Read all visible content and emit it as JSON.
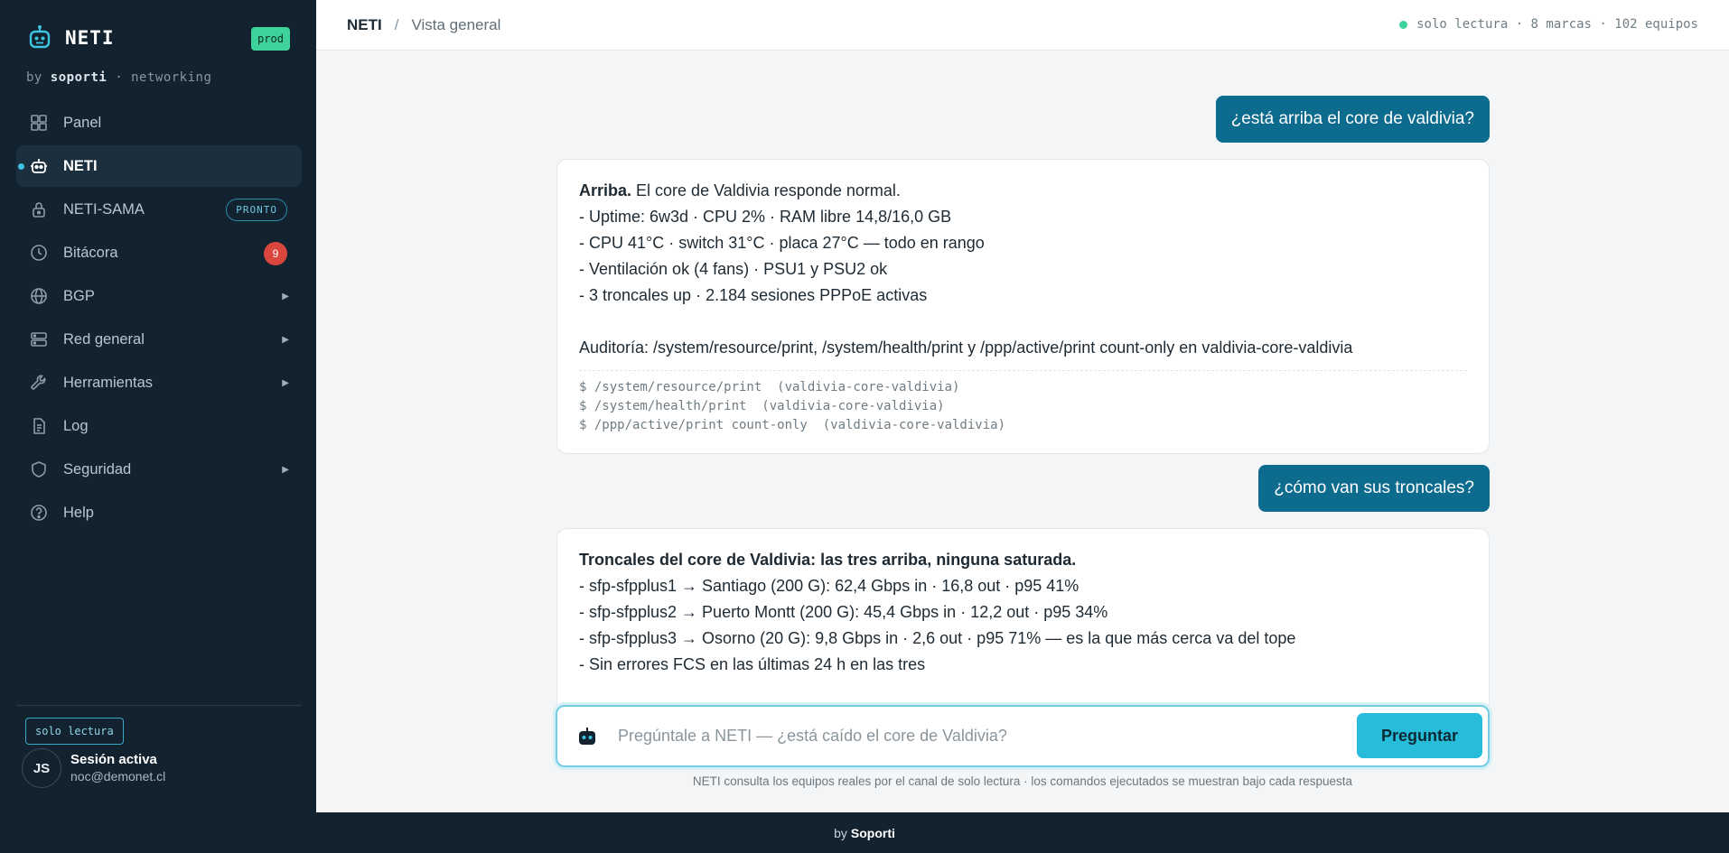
{
  "sidebar": {
    "brand": "NETI",
    "env_badge": "prod",
    "byline_prefix": "by",
    "byline_company": "soporti",
    "byline_suffix": "· networking",
    "items": [
      {
        "label": "Panel",
        "icon": "grid-icon"
      },
      {
        "label": "NETI",
        "icon": "bot-icon",
        "active": true
      },
      {
        "label": "NETI-SAMA",
        "icon": "lock-icon",
        "badge": "PRONTO"
      },
      {
        "label": "Bitácora",
        "icon": "clock-icon",
        "count": "9"
      },
      {
        "label": "BGP",
        "icon": "globe-icon",
        "expandable": true
      },
      {
        "label": "Red general",
        "icon": "server-icon",
        "expandable": true
      },
      {
        "label": "Herramientas",
        "icon": "wrench-icon",
        "expandable": true
      },
      {
        "label": "Log",
        "icon": "document-icon"
      },
      {
        "label": "Seguridad",
        "icon": "shield-icon",
        "expandable": true
      },
      {
        "label": "Help",
        "icon": "help-icon"
      }
    ],
    "readonly_chip": "solo lectura",
    "avatar_initials": "JS",
    "session_title": "Sesión activa",
    "session_email": "noc@demonet.cl"
  },
  "header": {
    "breadcrumb_root": "NETI",
    "breadcrumb_separator": "/",
    "breadcrumb_page": "Vista general",
    "status_text": "solo lectura · 8 marcas · 102 equipos"
  },
  "chat": {
    "q1": "¿está arriba el core de valdivia?",
    "a1": {
      "lead": "Arriba.",
      "lead_rest": " El core de Valdivia responde normal.",
      "lines": [
        "- Uptime: 6w3d · CPU 2% · RAM libre 14,8/16,0 GB",
        "- CPU 41°C · switch 31°C · placa 27°C — todo en rango",
        "- Ventilación ok (4 fans) · PSU1 y PSU2 ok",
        "- 3 troncales up · 2.184 sesiones PPPoE activas"
      ],
      "audit": "Auditoría: /system/resource/print, /system/health/print y /ppp/active/print count-only en valdivia-core-valdivia",
      "commands": [
        "$ /system/resource/print  (valdivia-core-valdivia)",
        "$ /system/health/print  (valdivia-core-valdivia)",
        "$ /ppp/active/print count-only  (valdivia-core-valdivia)"
      ]
    },
    "q2": "¿cómo van sus troncales?",
    "a2": {
      "lead": "Troncales del core de Valdivia: las tres arriba, ninguna saturada.",
      "lines": [
        "- sfp-sfpplus1 → Santiago (200 G): 62,4 Gbps in · 16,8 out · p95 41%",
        "- sfp-sfpplus2 → Puerto Montt (200 G): 45,4 Gbps in · 12,2 out · p95 34%",
        "- sfp-sfpplus3 → Osorno (20 G): 9,8 Gbps in · 2,6 out · p95 71% — es la que más cerca va del tope",
        "- Sin errores FCS en las últimas 24 h en las tres"
      ]
    }
  },
  "composer": {
    "placeholder": "Pregúntale a NETI — ¿está caído el core de Valdivia?",
    "value": "",
    "button": "Preguntar",
    "hint": "NETI consulta los equipos reales por el canal de solo lectura · los comandos ejecutados se muestran bajo cada respuesta"
  },
  "footer": {
    "prefix": "by",
    "company": "Soporti"
  },
  "colors": {
    "sidebar_bg": "#12222f",
    "accent": "#27bcd9",
    "user_bubble": "#0d6b8e",
    "ok_green": "#3ed39a",
    "alert_red": "#d9463e"
  }
}
